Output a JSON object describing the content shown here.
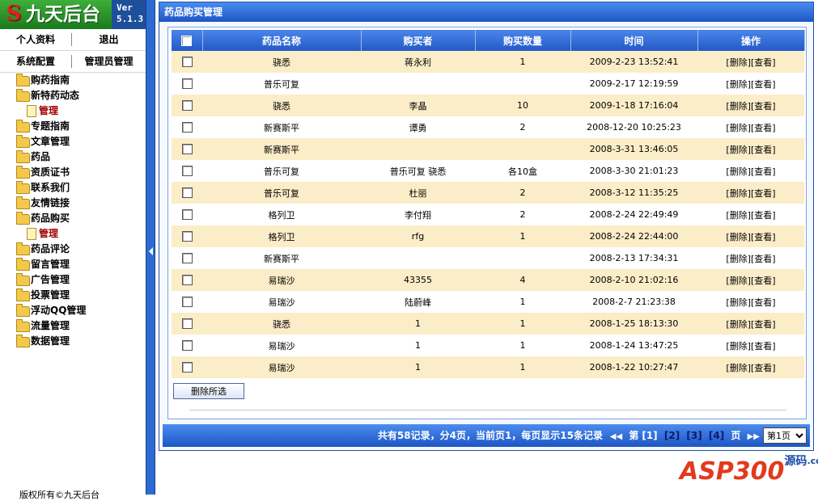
{
  "sidebar": {
    "logo_mark": "S",
    "logo_title": "九天后台",
    "version_label": "Ver",
    "version_number": "5.1.3",
    "row1": {
      "left": "个人资料",
      "right": "退出"
    },
    "row2": {
      "left": "系统配置",
      "right": "管理员管理"
    },
    "menu": [
      {
        "label": "购药指南"
      },
      {
        "label": "新特药动态",
        "sub": "管理"
      },
      {
        "label": "专题指南"
      },
      {
        "label": "文章管理"
      },
      {
        "label": "药品"
      },
      {
        "label": "资质证书"
      },
      {
        "label": "联系我们"
      },
      {
        "label": "友情链接"
      },
      {
        "label": "药品购买",
        "sub": "管理"
      },
      {
        "label": "药品评论"
      },
      {
        "label": "留言管理"
      },
      {
        "label": "广告管理"
      },
      {
        "label": "投票管理"
      },
      {
        "label": "浮动QQ管理"
      },
      {
        "label": "流量管理"
      },
      {
        "label": "数据管理"
      }
    ],
    "copyright": "版权所有©九天后台"
  },
  "panel": {
    "title": "药品购买管理",
    "columns": [
      "药品名称",
      "购买者",
      "购买数量",
      "时间",
      "操作"
    ],
    "rows": [
      {
        "name": "骁悉",
        "buyer": "蒋永利",
        "qty": "1",
        "time": "2009-2-23 13:52:41",
        "op": "[删除][查看]"
      },
      {
        "name": "普乐可复",
        "buyer": "",
        "qty": "",
        "time": "2009-2-17 12:19:59",
        "op": "[删除][查看]"
      },
      {
        "name": "骁悉",
        "buyer": "李晶",
        "qty": "10",
        "time": "2009-1-18 17:16:04",
        "op": "[删除][查看]"
      },
      {
        "name": "新赛斯平",
        "buyer": "谭勇",
        "qty": "2",
        "time": "2008-12-20 10:25:23",
        "op": "[删除][查看]"
      },
      {
        "name": "新赛斯平",
        "buyer": "",
        "qty": "",
        "time": "2008-3-31 13:46:05",
        "op": "[删除][查看]"
      },
      {
        "name": "普乐可复",
        "buyer": "普乐可复 骁悉",
        "qty": "各10盒",
        "time": "2008-3-30 21:01:23",
        "op": "[删除][查看]"
      },
      {
        "name": "普乐可复",
        "buyer": "杜丽",
        "qty": "2",
        "time": "2008-3-12 11:35:25",
        "op": "[删除][查看]"
      },
      {
        "name": "格列卫",
        "buyer": "李付翔",
        "qty": "2",
        "time": "2008-2-24 22:49:49",
        "op": "[删除][查看]"
      },
      {
        "name": "格列卫",
        "buyer": "rfg",
        "qty": "1",
        "time": "2008-2-24 22:44:00",
        "op": "[删除][查看]"
      },
      {
        "name": "新赛斯平",
        "buyer": "",
        "qty": "",
        "time": "2008-2-13 17:34:31",
        "op": "[删除][查看]"
      },
      {
        "name": "易瑞沙",
        "buyer": "43355",
        "qty": "4",
        "time": "2008-2-10 21:02:16",
        "op": "[删除][查看]"
      },
      {
        "name": "易瑞沙",
        "buyer": "陆蔚峰",
        "qty": "1",
        "time": "2008-2-7 21:23:38",
        "op": "[删除][查看]"
      },
      {
        "name": "骁悉",
        "buyer": "1",
        "qty": "1",
        "time": "2008-1-25 18:13:30",
        "op": "[删除][查看]"
      },
      {
        "name": "易瑞沙",
        "buyer": "1",
        "qty": "1",
        "time": "2008-1-24 13:47:25",
        "op": "[删除][查看]"
      },
      {
        "name": "易瑞沙",
        "buyer": "1",
        "qty": "1",
        "time": "2008-1-22 10:27:47",
        "op": "[删除][查看]"
      }
    ],
    "delete_selected_label": "删除所选"
  },
  "pager": {
    "summary": "共有58记录，分4页，当前页1，每页显示15条记录",
    "prev_icon": "◀◀",
    "page_prefix": "第",
    "current": "[1]",
    "pages": [
      "[2]",
      "[3]",
      "[4]"
    ],
    "page_suffix": "页",
    "next_icon": "▶▶",
    "select_value": "第1页"
  },
  "watermark": {
    "text": "ASP300",
    "suffix": "源码",
    "domain": ".com"
  }
}
